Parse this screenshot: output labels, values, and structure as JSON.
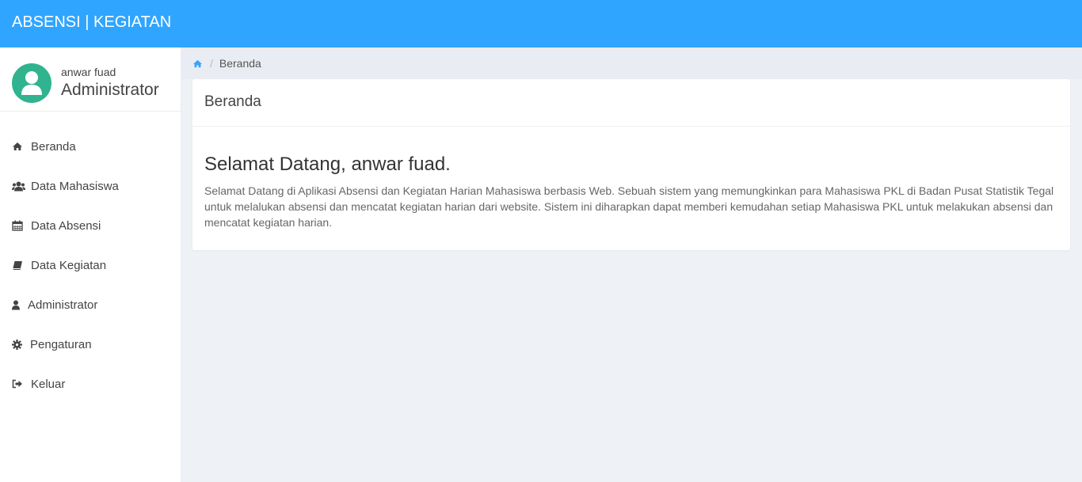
{
  "app": {
    "title": "ABSENSI | KEGIATAN"
  },
  "colors": {
    "topbar": "#30a5ff",
    "avatar": "#30b38e",
    "content_bg": "#eef1f6",
    "breadcrumb_bg": "#e9ecf2"
  },
  "profile": {
    "name": "anwar fuad",
    "role": "Administrator"
  },
  "sidebar": {
    "items": [
      {
        "label": "Beranda",
        "icon": "home-icon"
      },
      {
        "label": "Data Mahasiswa",
        "icon": "users-icon"
      },
      {
        "label": "Data Absensi",
        "icon": "calendar-icon"
      },
      {
        "label": "Data Kegiatan",
        "icon": "book-icon"
      },
      {
        "label": "Administrator",
        "icon": "user-icon"
      },
      {
        "label": "Pengaturan",
        "icon": "gear-icon"
      },
      {
        "label": "Keluar",
        "icon": "sign-out-icon"
      }
    ]
  },
  "breadcrumb": {
    "separator": "/",
    "current": "Beranda"
  },
  "panel": {
    "heading": "Beranda",
    "welcome_title": "Selamat Datang, anwar fuad.",
    "welcome_text": "Selamat Datang di Aplikasi Absensi dan Kegiatan Harian Mahasiswa berbasis Web. Sebuah sistem yang memungkinkan para Mahasiswa PKL di Badan Pusat Statistik Tegal untuk melalukan absensi dan mencatat kegiatan harian dari website. Sistem ini diharapkan dapat memberi kemudahan setiap Mahasiswa PKL untuk melakukan absensi dan mencatat kegiatan harian."
  }
}
